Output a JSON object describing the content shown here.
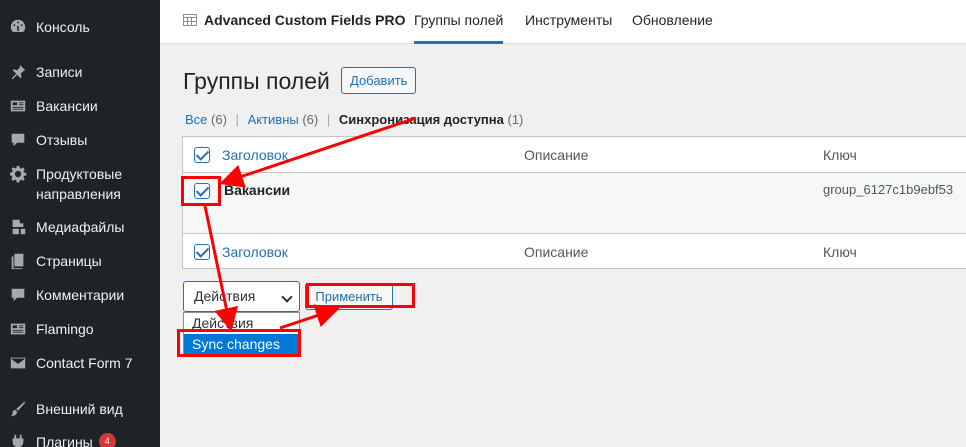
{
  "sidebar": {
    "items": [
      {
        "icon": "dashboard-icon",
        "label": "Консоль"
      },
      {
        "icon": "pin-icon",
        "label": "Записи"
      },
      {
        "icon": "id-card-icon",
        "label": "Вакансии"
      },
      {
        "icon": "comment-icon",
        "label": "Отзывы"
      },
      {
        "icon": "gear-icon",
        "label": "Продуктовые направления"
      },
      {
        "icon": "media-icon",
        "label": "Медиафайлы"
      },
      {
        "icon": "pages-icon",
        "label": "Страницы"
      },
      {
        "icon": "comment-icon",
        "label": "Комментарии"
      },
      {
        "icon": "id-card-icon",
        "label": "Flamingo"
      },
      {
        "icon": "mail-icon",
        "label": "Contact Form 7"
      },
      {
        "icon": "brush-icon",
        "label": "Внешний вид"
      },
      {
        "icon": "plugin-icon",
        "label": "Плагины",
        "badge": "4"
      }
    ]
  },
  "topnav": {
    "brand": "Advanced Custom Fields PRO",
    "tabs": [
      "Группы полей",
      "Инструменты",
      "Обновление"
    ],
    "active_tab": "Группы полей"
  },
  "page": {
    "title": "Группы полей",
    "add_button": "Добавить"
  },
  "filters": {
    "all": {
      "label": "Все",
      "count": "(6)"
    },
    "active": {
      "label": "Активны",
      "count": "(6)"
    },
    "sync": {
      "label": "Синхронизация доступна",
      "count": "(1)"
    },
    "separator": "|"
  },
  "table": {
    "columns": [
      "Заголовок",
      "Описание",
      "Ключ"
    ],
    "rows": [
      {
        "title": "Вакансии",
        "description": "",
        "key": "group_6127c1b9ebf53"
      }
    ]
  },
  "bulk": {
    "select_value": "Действия",
    "options": [
      "Действия",
      "Sync changes"
    ],
    "selected_option": "Sync changes",
    "apply_button": "Применить"
  },
  "colors": {
    "sidebar_bg": "#1d2327",
    "accent": "#2271b1",
    "annotation": "#ff0000"
  }
}
